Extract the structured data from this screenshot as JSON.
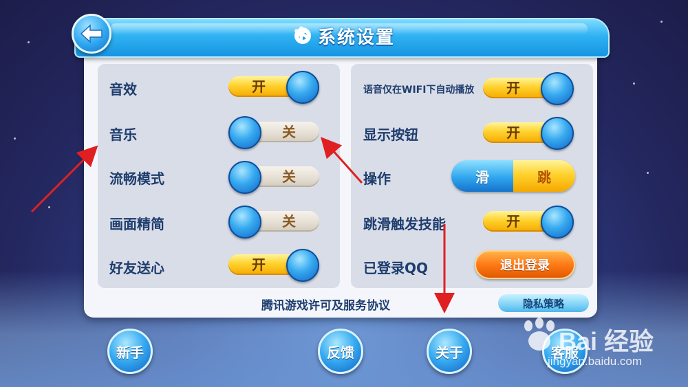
{
  "header": {
    "title": "系统设置",
    "back_icon": "arrow-left-icon",
    "settings_icon": "gear-icon"
  },
  "left_settings": [
    {
      "label": "音效",
      "state": "on",
      "state_label": "开"
    },
    {
      "label": "音乐",
      "state": "off",
      "state_label": "关"
    },
    {
      "label": "流畅模式",
      "state": "off",
      "state_label": "关"
    },
    {
      "label": "画面精简",
      "state": "off",
      "state_label": "关"
    },
    {
      "label": "好友送心",
      "state": "on",
      "state_label": "开"
    }
  ],
  "right_settings": {
    "voice_wifi": {
      "label": "语音仅在WIFI下自动播放",
      "state": "on",
      "state_label": "开"
    },
    "show_buttons": {
      "label": "显示按钮",
      "state": "on",
      "state_label": "开"
    },
    "operation": {
      "label": "操作",
      "option_a": "滑",
      "option_b": "跳"
    },
    "jump_slide_skill": {
      "label": "跳滑触发技能",
      "state": "on",
      "state_label": "开"
    },
    "qq": {
      "label": "已登录QQ",
      "logout_label": "退出登录"
    }
  },
  "footer": {
    "agreement_link": "腾讯游戏许可及服务协议",
    "privacy_button": "隐私策略"
  },
  "bottom_buttons": [
    "新手",
    "反馈",
    "关于",
    "客服"
  ],
  "watermark": {
    "brand": "Bai 经验",
    "url": "jingyan.baidu.com"
  },
  "colors": {
    "toggle_on": "#ffd22e",
    "knob": "#2a9ee8",
    "annotation_arrow": "#e02020",
    "logout": "#ff7a16"
  }
}
